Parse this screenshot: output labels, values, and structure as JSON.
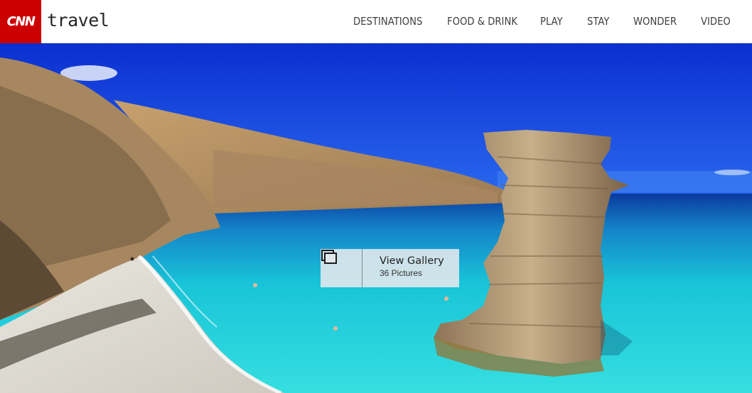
{
  "header": {
    "logo": "CNN",
    "brand": "travel",
    "nav": [
      "DESTINATIONS",
      "FOOD & DRINK",
      "PLAY",
      "STAY",
      "WONDER",
      "VIDEO"
    ]
  },
  "hero": {
    "gallery_title": "View Gallery",
    "gallery_count": "36 Pictures",
    "gallery_icon": "gallery-stack-icon"
  },
  "colors": {
    "cnn_red": "#cc0000",
    "sky": "#0a35d8",
    "sea_turquoise": "#1ec6d6",
    "sea_deep": "#0b3fa6",
    "rock": "#b59a74"
  }
}
